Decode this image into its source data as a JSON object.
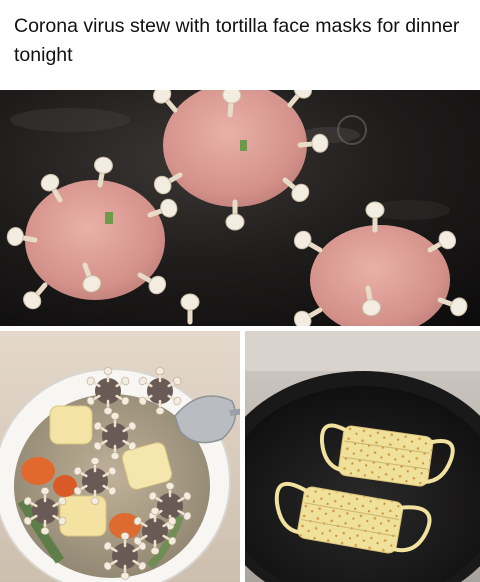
{
  "post": {
    "caption": "Corona virus stew with tortilla face masks for dinner tonight"
  },
  "photos": [
    {
      "name": "meatballs-in-pan",
      "subject": "pink meatballs studded with enoki mushrooms frying in a black pan"
    },
    {
      "name": "stew-bowl",
      "subject": "white bowl of broth with tofu cubes, carrot slices and mushroom-studded meatballs, spoon at right"
    },
    {
      "name": "tortilla-masks",
      "subject": "two tortilla face masks with egg crepe ear loops in a black frying pan"
    }
  ],
  "colors": {
    "background": "#ffffff",
    "text": "#111111",
    "pan": "#1b1a1a",
    "meat": "#d99a93",
    "mushroom": "#efe6d6",
    "tortilla": "#efe19a"
  }
}
